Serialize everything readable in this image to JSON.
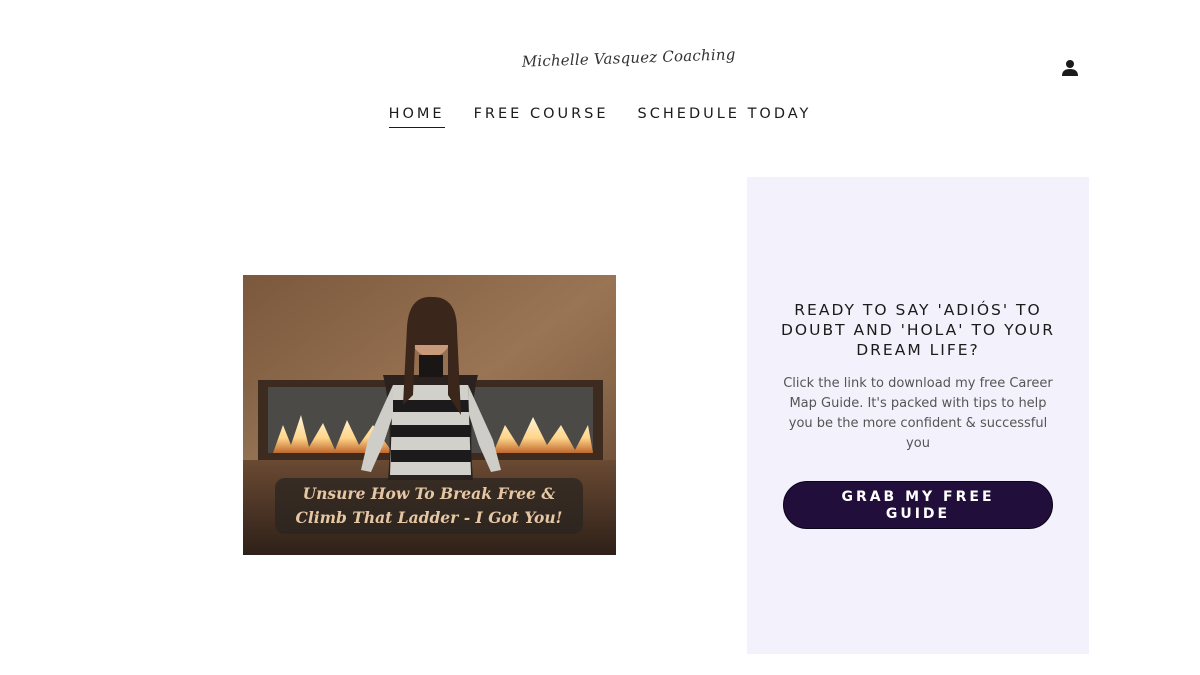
{
  "brand": {
    "logo_text": "Michelle Vasquez Coaching"
  },
  "header": {
    "account_icon": "user-icon"
  },
  "nav": {
    "items": [
      {
        "label": "HOME",
        "active": true
      },
      {
        "label": "FREE COURSE",
        "active": false
      },
      {
        "label": "SCHEDULE TODAY",
        "active": false
      }
    ]
  },
  "hero": {
    "caption_line1": "Unsure How To Break Free &",
    "caption_line2": "Climb That Ladder - I Got You!"
  },
  "cta": {
    "heading": "READY TO SAY 'ADIÓS' TO DOUBT AND 'HOLA' TO YOUR DREAM LIFE?",
    "body": "Click the link to download my free Career Map Guide. It's packed with tips to help you be the more confident & successful you",
    "button_label": "GRAB MY FREE GUIDE",
    "button_color": "#220e3a",
    "panel_color": "#f3f1fc"
  }
}
